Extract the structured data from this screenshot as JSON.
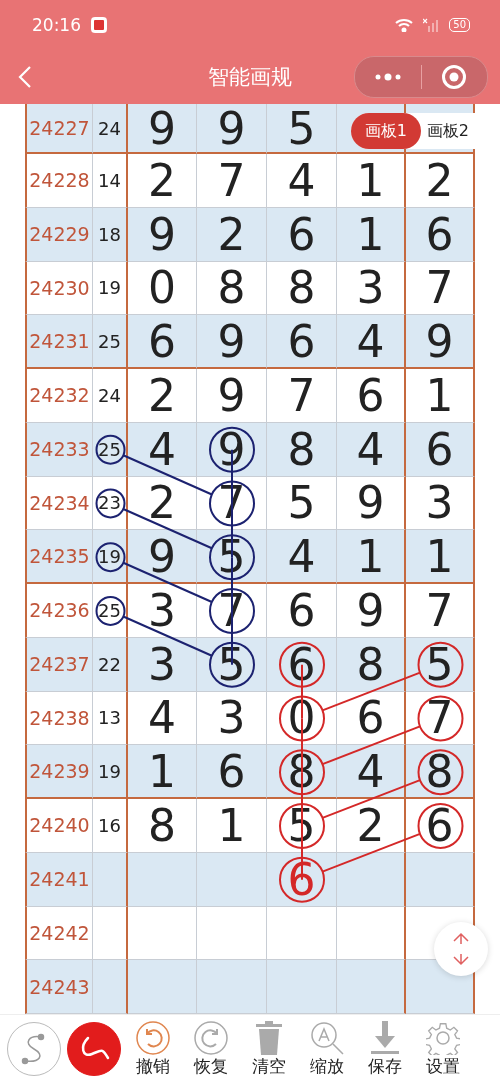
{
  "status_bar": {
    "time": "20:16",
    "battery": "50"
  },
  "nav": {
    "title": "智能画规"
  },
  "board_tabs": [
    {
      "label": "画板1",
      "selected": true
    },
    {
      "label": "画板2",
      "selected": false
    }
  ],
  "rows": [
    {
      "period": "24227",
      "sum": {
        "value": "24"
      },
      "digits": [
        {
          "value": "9"
        },
        {
          "value": "9"
        },
        {
          "value": "5"
        }
      ]
    },
    {
      "period": "24228",
      "sum": {
        "value": "14"
      },
      "digits": [
        {
          "value": "2"
        },
        {
          "value": "7"
        },
        {
          "value": "4"
        },
        {
          "value": "1"
        },
        {
          "value": "2"
        }
      ]
    },
    {
      "period": "24229",
      "sum": {
        "value": "18"
      },
      "digits": [
        {
          "value": "9"
        },
        {
          "value": "2"
        },
        {
          "value": "6"
        },
        {
          "value": "1"
        },
        {
          "value": "6"
        }
      ]
    },
    {
      "period": "24230",
      "sum": {
        "value": "19"
      },
      "digits": [
        {
          "value": "0"
        },
        {
          "value": "8"
        },
        {
          "value": "8"
        },
        {
          "value": "3"
        },
        {
          "value": "7"
        }
      ]
    },
    {
      "period": "24231",
      "sum": {
        "value": "25"
      },
      "digits": [
        {
          "value": "6"
        },
        {
          "value": "9"
        },
        {
          "value": "6"
        },
        {
          "value": "4"
        },
        {
          "value": "9"
        }
      ]
    },
    {
      "period": "24232",
      "sum": {
        "value": "24"
      },
      "digits": [
        {
          "value": "2"
        },
        {
          "value": "9"
        },
        {
          "value": "7"
        },
        {
          "value": "6"
        },
        {
          "value": "1"
        }
      ]
    },
    {
      "period": "24233",
      "sum": {
        "value": "25",
        "color": "#1c2270",
        "link_down_right": true
      },
      "digits": [
        {
          "value": "4"
        },
        {
          "value": "9",
          "color": "#1c2270",
          "link_down": true
        },
        {
          "value": "8"
        },
        {
          "value": "4"
        },
        {
          "value": "6"
        }
      ]
    },
    {
      "period": "24234",
      "sum": {
        "value": "23",
        "color": "#1c2270",
        "link_down_right": true
      },
      "digits": [
        {
          "value": "2"
        },
        {
          "value": "7",
          "color": "#1c2270",
          "link_down": true
        },
        {
          "value": "5"
        },
        {
          "value": "9"
        },
        {
          "value": "3"
        }
      ]
    },
    {
      "period": "24235",
      "sum": {
        "value": "19",
        "color": "#1c2270",
        "link_down_right": true
      },
      "digits": [
        {
          "value": "9"
        },
        {
          "value": "5",
          "color": "#1c2270",
          "link_down": true
        },
        {
          "value": "4"
        },
        {
          "value": "1"
        },
        {
          "value": "1"
        }
      ]
    },
    {
      "period": "24236",
      "sum": {
        "value": "25",
        "color": "#1c2270",
        "link_down_right": true
      },
      "digits": [
        {
          "value": "3"
        },
        {
          "value": "7",
          "color": "#1c2270",
          "link_down": true
        },
        {
          "value": "6"
        },
        {
          "value": "9"
        },
        {
          "value": "7"
        }
      ]
    },
    {
      "period": "24237",
      "sum": {
        "value": "22"
      },
      "digits": [
        {
          "value": "3"
        },
        {
          "value": "5",
          "color": "#1c2270"
        },
        {
          "value": "6",
          "color": "#d42828",
          "link_down": true
        },
        {
          "value": "8"
        },
        {
          "value": "5",
          "color": "#d42828"
        }
      ]
    },
    {
      "period": "24238",
      "sum": {
        "value": "13"
      },
      "digits": [
        {
          "value": "4"
        },
        {
          "value": "3"
        },
        {
          "value": "0",
          "color": "#d42828",
          "link_down": true,
          "link_up_right": true
        },
        {
          "value": "6"
        },
        {
          "value": "7",
          "color": "#d42828"
        }
      ]
    },
    {
      "period": "24239",
      "sum": {
        "value": "19"
      },
      "digits": [
        {
          "value": "1"
        },
        {
          "value": "6"
        },
        {
          "value": "8",
          "color": "#d42828",
          "link_down": true,
          "link_up_right": true
        },
        {
          "value": "4"
        },
        {
          "value": "8",
          "color": "#d42828"
        }
      ]
    },
    {
      "period": "24240",
      "sum": {
        "value": "16"
      },
      "digits": [
        {
          "value": "8"
        },
        {
          "value": "1"
        },
        {
          "value": "5",
          "color": "#d42828",
          "link_down": true,
          "link_up_right": true
        },
        {
          "value": "2"
        },
        {
          "value": "6",
          "color": "#d42828"
        }
      ]
    },
    {
      "period": "24241",
      "projected": true,
      "digits": [
        {
          "empty": true
        },
        {
          "empty": true
        },
        {
          "value": "6",
          "color": "#d42828",
          "link_up_right": true
        }
      ]
    },
    {
      "period": "24242"
    },
    {
      "period": "24243"
    }
  ],
  "pen_modes": [
    {
      "kind": "curve",
      "selected": false
    },
    {
      "kind": "freehand",
      "selected": true
    }
  ],
  "tools": [
    {
      "kind": "undo",
      "label": "撤销",
      "active": true
    },
    {
      "kind": "redo",
      "label": "恢复",
      "active": false
    },
    {
      "kind": "clear",
      "label": "清空",
      "active": false
    },
    {
      "kind": "zoom",
      "label": "缩放",
      "active": false
    },
    {
      "kind": "save",
      "label": "保存",
      "active": false
    },
    {
      "kind": "settings",
      "label": "设置",
      "active": false
    }
  ]
}
